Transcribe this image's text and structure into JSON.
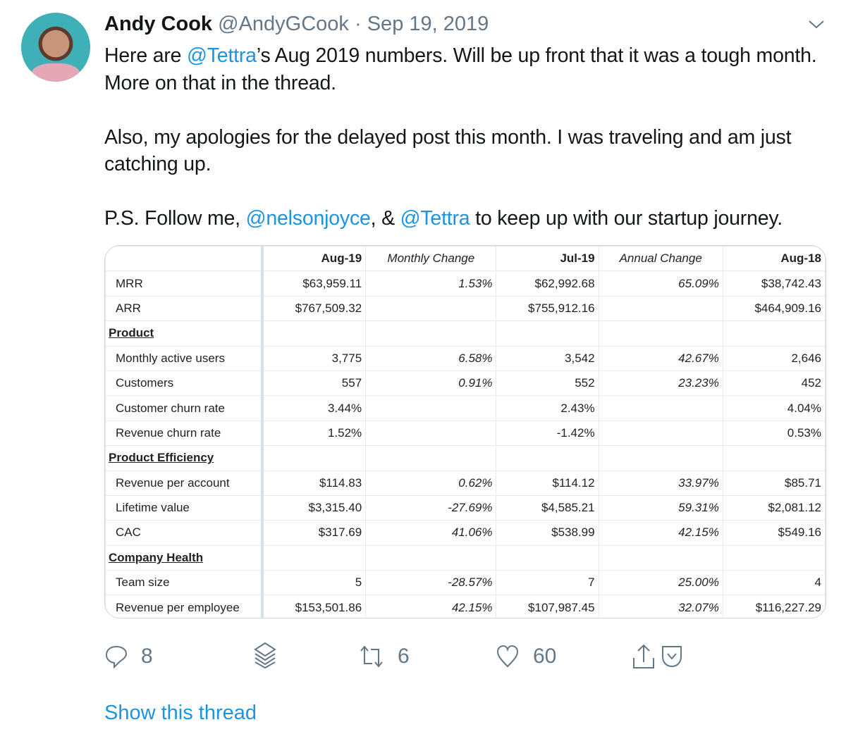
{
  "tweet": {
    "name": "Andy Cook",
    "handle": "@AndyGCook",
    "dot": "·",
    "date": "Sep 19, 2019",
    "p1": {
      "a": "Here are ",
      "m": "@Tettra",
      "b": "’s Aug 2019 numbers. Will be up front that it was a tough month. More on that in the thread."
    },
    "p2": "Also, my apologies for the delayed post this month. I was traveling and am just catching up.",
    "p3": {
      "a": "P.S. Follow me, ",
      "m1": "@nelsonjoyce",
      "b": ", & ",
      "m2": "@Tettra",
      "c": " to keep up with our startup journey."
    }
  },
  "table": {
    "headers": [
      "",
      "Aug-19",
      "Monthly Change",
      "Jul-19",
      "Annual Change",
      "Aug-18"
    ],
    "rows": [
      [
        "MRR",
        "$63,959.11",
        "1.53%",
        "$62,992.68",
        "65.09%",
        "$38,742.43"
      ],
      [
        "ARR",
        "$767,509.32",
        "",
        "$755,912.16",
        "",
        "$464,909.16"
      ],
      [
        "Product",
        "",
        "",
        "",
        "",
        ""
      ],
      [
        "Monthly active users",
        "3,775",
        "6.58%",
        "3,542",
        "42.67%",
        "2,646"
      ],
      [
        "Customers",
        "557",
        "0.91%",
        "552",
        "23.23%",
        "452"
      ],
      [
        "Customer churn rate",
        "3.44%",
        "",
        "2.43%",
        "",
        "4.04%"
      ],
      [
        "Revenue churn rate",
        "1.52%",
        "",
        "-1.42%",
        "",
        "0.53%"
      ],
      [
        "Product Efficiency",
        "",
        "",
        "",
        "",
        ""
      ],
      [
        "Revenue per account",
        "$114.83",
        "0.62%",
        "$114.12",
        "33.97%",
        "$85.71"
      ],
      [
        "Lifetime value",
        "$3,315.40",
        "-27.69%",
        "$4,585.21",
        "59.31%",
        "$2,081.12"
      ],
      [
        "CAC",
        "$317.69",
        "41.06%",
        "$538.99",
        "42.15%",
        "$549.16"
      ],
      [
        "Company Health",
        "",
        "",
        "",
        "",
        ""
      ],
      [
        "Team size",
        "5",
        "-28.57%",
        "7",
        "25.00%",
        "4"
      ],
      [
        "Revenue per employee",
        "$153,501.86",
        "42.15%",
        "$107,987.45",
        "32.07%",
        "$116,227.29"
      ]
    ],
    "sections": [
      "Product",
      "Product Efficiency",
      "Company Health"
    ]
  },
  "actions": {
    "replies": "8",
    "retweets": "6",
    "likes": "60"
  },
  "show_thread": "Show this thread",
  "colors": {
    "link": "#1b95e0",
    "muted": "#657786"
  }
}
